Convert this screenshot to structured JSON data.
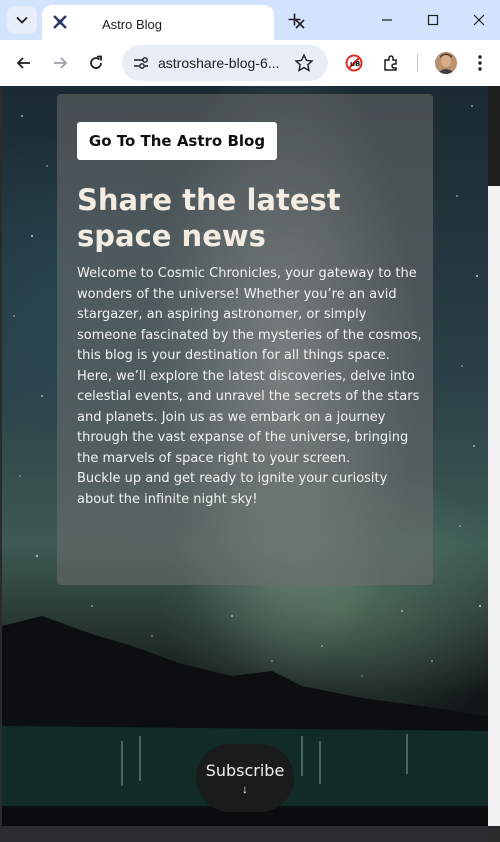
{
  "browser": {
    "tab_title": "Astro Blog",
    "url": "astroshare-blog-6..."
  },
  "page": {
    "cta_label": "Go To The Astro Blog",
    "title": "Share the latest space news",
    "paragraphs": [
      "Welcome to Cosmic Chronicles, your gateway to the wonders of the universe! Whether you’re an avid stargazer, an aspiring astronomer, or simply someone fascinated by the mysteries of the cosmos, this blog is your destination for all things space.",
      "Here, we’ll explore the latest discoveries, delve into celestial events, and unravel the secrets of the stars and planets. Join us as we embark on a journey through the vast expanse of the universe, bringing the marvels of space right to your screen.",
      "Buckle up and get ready to ignite your curiosity about the infinite night sky!"
    ],
    "subscribe_label": "Subscribe",
    "subscribe_arrow": "↓"
  },
  "colors": {
    "tabbar": "#d3e3fd",
    "card": "#6e6e6e",
    "title": "#f3ece3"
  },
  "icons": [
    "tab-search-icon",
    "favicon-icon",
    "close-icon",
    "plus-icon",
    "minimize-icon",
    "maximize-icon",
    "back-icon",
    "forward-icon",
    "reload-icon",
    "site-info-icon",
    "star-icon",
    "blocked-extension-icon",
    "puzzle-icon",
    "kebab-menu-icon"
  ]
}
